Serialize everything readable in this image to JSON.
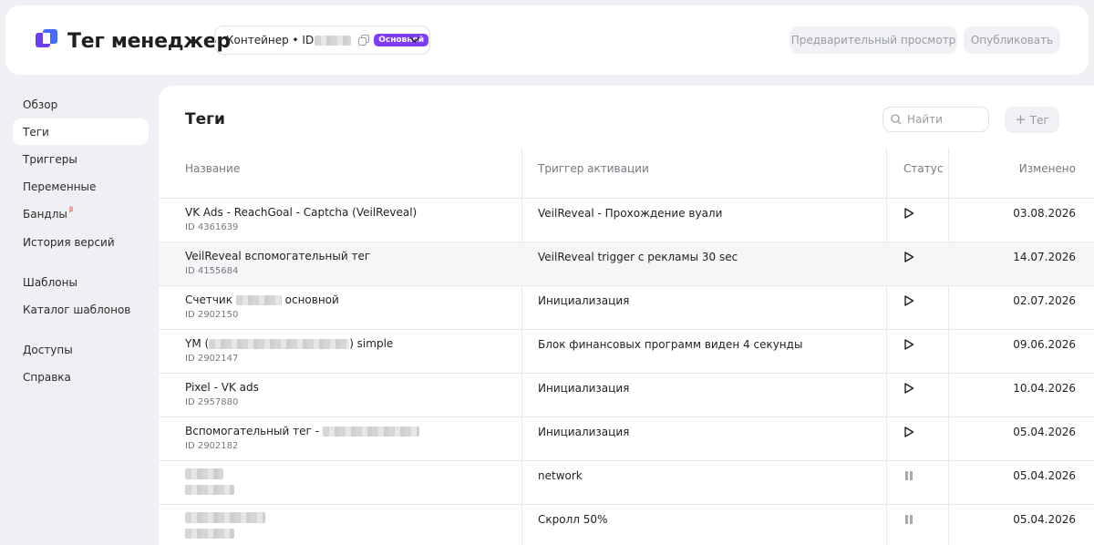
{
  "header": {
    "app_title": "Тег менеджер",
    "container_label": "Контейнер • ID",
    "container_badge": "Основной",
    "preview_button": "Предварительный просмотр",
    "publish_button": "Опубликовать"
  },
  "colors": {
    "accent": "#7e3ff2",
    "logo_blue": "#2f5bff",
    "badge_red": "#e0342f"
  },
  "sidebar": {
    "items": [
      {
        "label": "Обзор"
      },
      {
        "label": "Теги",
        "active": true
      },
      {
        "label": "Триггеры"
      },
      {
        "label": "Переменные"
      },
      {
        "label": "Бандлы",
        "badge": "β"
      },
      {
        "label": "История версий"
      },
      {
        "label": "Шаблоны"
      },
      {
        "label": "Каталог шаблонов"
      },
      {
        "label": "Доступы"
      },
      {
        "label": "Справка"
      }
    ]
  },
  "main": {
    "title": "Теги",
    "search_placeholder": "Найти",
    "add_button": "Тег",
    "columns": {
      "name": "Название",
      "trigger": "Триггер активации",
      "status": "Статус",
      "modified": "Изменено"
    }
  },
  "rows": [
    {
      "name": "VK Ads - ReachGoal - Captcha (VeilReveal)",
      "id": "ID 4361639",
      "trigger": "VeilReveal - Прохождение вуали",
      "status": "active",
      "date": "03.08.2026"
    },
    {
      "name": "VeilReveal вспомогательный тег",
      "id": "ID 4155684",
      "trigger": "VeilReveal trigger с рекламы 30 sec",
      "status": "active",
      "date": "14.07.2026"
    },
    {
      "name_prefix": "Счетчик",
      "name_suffix": "основной",
      "id": "ID 2902150",
      "trigger": "Инициализация",
      "status": "active",
      "date": "02.07.2026"
    },
    {
      "name_prefix": "YM (",
      "name_suffix": ") simple",
      "id": "ID 2902147",
      "trigger": "Блок финансовых программ виден 4 секунды",
      "status": "active",
      "date": "09.06.2026"
    },
    {
      "name": "Pixel - VK ads",
      "id": "ID 2957880",
      "trigger": "Инициализация",
      "status": "active",
      "date": "10.04.2026"
    },
    {
      "name_prefix": "Вспомогательный тег -",
      "id": "ID 2902182",
      "trigger": "Инициализация",
      "status": "active",
      "date": "05.04.2026"
    },
    {
      "trigger": "network",
      "status": "paused",
      "date": "05.04.2026"
    },
    {
      "trigger": "Скролл 50%",
      "status": "paused",
      "date": "05.04.2026"
    }
  ]
}
